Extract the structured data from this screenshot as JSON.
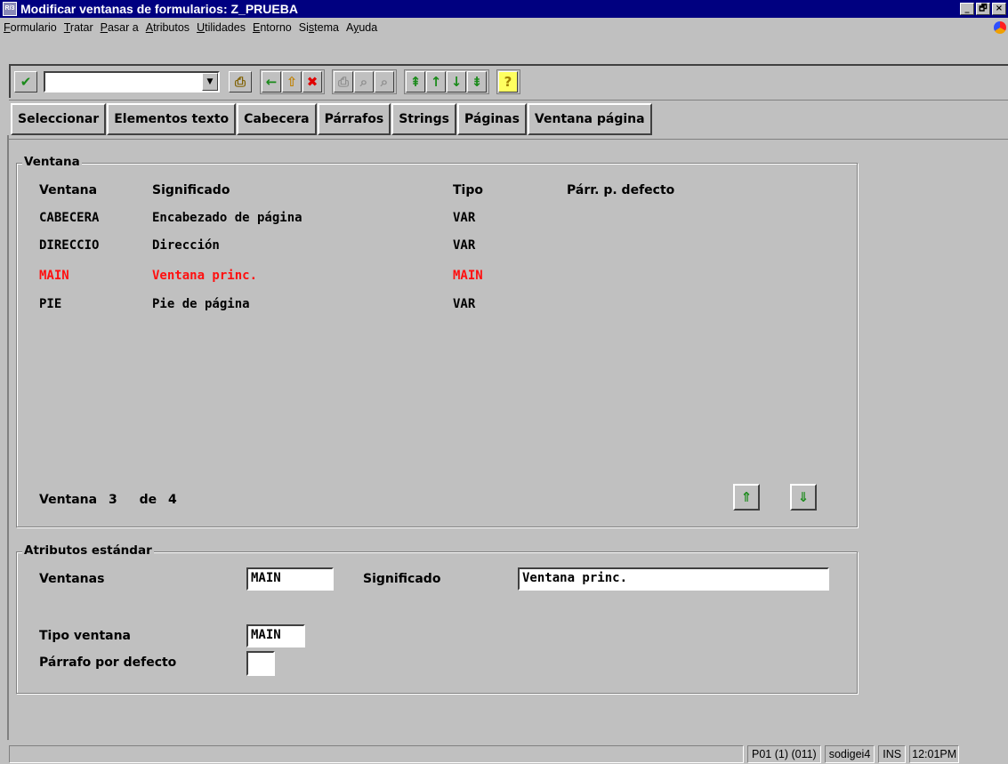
{
  "window": {
    "title": "Modificar ventanas de formularios: Z_PRUEBA",
    "controls": [
      "_",
      "🗗",
      "×"
    ]
  },
  "menu": [
    {
      "pre": "",
      "key": "F",
      "post": "ormulario"
    },
    {
      "pre": "",
      "key": "T",
      "post": "ratar"
    },
    {
      "pre": "",
      "key": "P",
      "post": "asar a"
    },
    {
      "pre": "",
      "key": "A",
      "post": "tributos"
    },
    {
      "pre": "",
      "key": "U",
      "post": "tilidades"
    },
    {
      "pre": "",
      "key": "E",
      "post": "ntorno"
    },
    {
      "pre": "Si",
      "key": "s",
      "post": "tema"
    },
    {
      "pre": "A",
      "key": "y",
      "post": "uda"
    }
  ],
  "command_field": {
    "value": ""
  },
  "app_buttons": [
    "Seleccionar",
    "Elementos texto",
    "Cabecera",
    "Párrafos",
    "Strings",
    "Páginas",
    "Ventana página"
  ],
  "ventana_group": {
    "title": "Ventana",
    "columns": [
      "Ventana",
      "Significado",
      "Tipo",
      "Párr. p. defecto"
    ],
    "rows": [
      {
        "ventana": "CABECERA",
        "significado": "Encabezado de página",
        "tipo": "VAR",
        "parr": ""
      },
      {
        "ventana": "DIRECCIO",
        "significado": "Dirección",
        "tipo": "VAR",
        "parr": ""
      },
      {
        "ventana": "MAIN",
        "significado": "Ventana princ.",
        "tipo": "MAIN",
        "parr": ""
      },
      {
        "ventana": "PIE",
        "significado": "Pie de página",
        "tipo": "VAR",
        "parr": ""
      }
    ],
    "selected_index": 2,
    "selected_color": "#ff1010",
    "counter": {
      "label": "Ventana",
      "current": "3",
      "of": "de",
      "total": "4"
    }
  },
  "attrs_group": {
    "title": "Atributos estándar",
    "ventanas_label": "Ventanas",
    "ventanas_value": "MAIN",
    "significado_label": "Significado",
    "significado_value": "Ventana princ.",
    "tipo_label": "Tipo ventana",
    "tipo_value": "MAIN",
    "parrafo_label": "Párrafo por defecto",
    "parrafo_value": ""
  },
  "status": {
    "system": "P01 (1) (011)",
    "server": "sodigei4",
    "mode": "INS",
    "time": "12:01PM"
  },
  "colors": {
    "titlebar": "#000080",
    "background": "#c0c0c0",
    "ok_icon": "#1a8a1a"
  }
}
